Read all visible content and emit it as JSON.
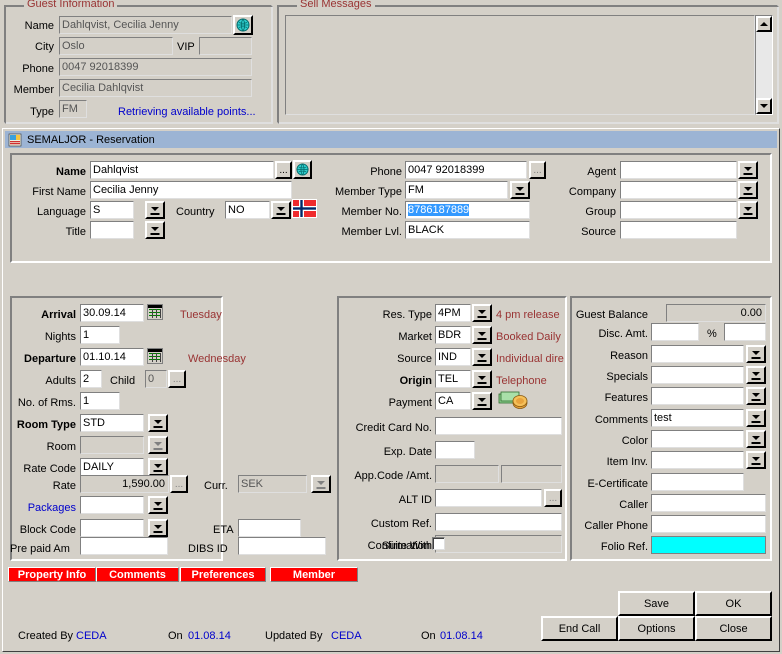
{
  "guest_information": {
    "title": "Guest Information",
    "fields": [
      {
        "label": "Name",
        "value": "Dahlqvist, Cecilia Jenny"
      },
      {
        "label": "City",
        "value": "Oslo"
      },
      {
        "label": "VIP",
        "value": ""
      },
      {
        "label": "Phone",
        "value": "0047  92018399"
      },
      {
        "label": "Member",
        "value": "Cecilia Dahlqvist"
      },
      {
        "label": "Type",
        "value": "FM"
      }
    ],
    "status_text": "Retrieving available points..."
  },
  "sell_messages": {
    "title": "Sell Messages",
    "body": ""
  },
  "window": {
    "title": "SEMALJOR - Reservation"
  },
  "name_section": {
    "name_label": "Name",
    "name_value": "Dahlqvist",
    "first_name_label": "First Name",
    "first_name_value": "Cecilia Jenny",
    "language_label": "Language",
    "language_value": "S",
    "country_label": "Country",
    "country_value": "NO",
    "title_label": "Title",
    "title_value": "",
    "phone_label": "Phone",
    "phone_value": "0047  92018399",
    "member_type_label": "Member Type",
    "member_type_value": "FM",
    "member_no_label": "Member No.",
    "member_no_value": "8786187889",
    "member_lvl_label": "Member Lvl.",
    "member_lvl_value": "BLACK",
    "agent_label": "Agent",
    "agent_value": "",
    "company_label": "Company",
    "company_value": "",
    "group_label": "Group",
    "group_value": "",
    "source_label": "Source",
    "source_value": ""
  },
  "stay_panel": {
    "arrival_label": "Arrival",
    "arrival_value": "30.09.14",
    "arrival_day": "Tuesday",
    "nights_label": "Nights",
    "nights_value": "1",
    "departure_label": "Departure",
    "departure_value": "01.10.14",
    "departure_day": "Wednesday",
    "adults_label": "Adults",
    "adults_value": "2",
    "child_label": "Child",
    "child_value": "0",
    "rooms_label": "No. of Rms.",
    "rooms_value": "1",
    "room_type_label": "Room Type",
    "room_type_value": "STD",
    "room_label": "Room",
    "room_value": "",
    "rate_code_label": "Rate Code",
    "rate_code_value": "DAILY",
    "rate_label": "Rate",
    "rate_value": "1,590.00",
    "curr_label": "Curr.",
    "curr_value": "SEK",
    "packages_label": "Packages",
    "packages_value": "",
    "block_code_label": "Block Code",
    "block_code_value": "",
    "eta_label": "ETA",
    "eta_value": "",
    "pre_paid_label": "Pre paid Am",
    "pre_paid_value": "",
    "dibs_label": "DIBS ID",
    "dibs_value": ""
  },
  "booking_panel": {
    "res_type_label": "Res. Type",
    "res_type_value": "4PM",
    "res_type_desc": "4 pm release",
    "market_label": "Market",
    "market_value": "BDR",
    "market_desc": "Booked Daily",
    "source_label": "Source",
    "source_value": "IND",
    "source_desc": "Individual dire",
    "origin_label": "Origin",
    "origin_value": "TEL",
    "origin_desc": "Telephone",
    "payment_label": "Payment",
    "payment_value": "CA",
    "credit_card_label": "Credit Card No.",
    "credit_card_value": "",
    "exp_date_label": "Exp. Date",
    "exp_date_value": "",
    "app_code_label": "App.Code /Amt.",
    "app_code_value": "",
    "app_amt_value": "",
    "alt_id_label": "ALT ID",
    "alt_id_value": "",
    "custom_ref_label": "Custom Ref.",
    "custom_ref_value": "",
    "suite_with_label": "Suite With",
    "suite_with_value": "",
    "confirmation_label": "Confirmation",
    "confirmation_checked": false
  },
  "financial_panel": {
    "guest_balance_label": "Guest Balance",
    "guest_balance_value": "0.00",
    "disc_amt_label": "Disc. Amt.",
    "disc_amt_value": "",
    "percent_label": "%",
    "percent_value": "",
    "reason_label": "Reason",
    "reason_value": "",
    "specials_label": "Specials",
    "specials_value": "",
    "features_label": "Features",
    "features_value": "",
    "comments_label": "Comments",
    "comments_value": "test",
    "color_label": "Color",
    "color_value": "",
    "item_inv_label": "Item Inv.",
    "item_inv_value": "",
    "e_certificate_label": "E-Certificate",
    "e_certificate_value": "",
    "caller_label": "Caller",
    "caller_value": "",
    "caller_phone_label": "Caller Phone",
    "caller_phone_value": "",
    "folio_ref_label": "Folio Ref.",
    "folio_ref_value": ""
  },
  "tabs": [
    {
      "label": "Property Info"
    },
    {
      "label": "Comments"
    },
    {
      "label": "Preferences"
    },
    {
      "label": "Member"
    }
  ],
  "footer": {
    "created_by_label": "Created By",
    "created_by_value": "CEDA",
    "created_on_label": "On",
    "created_on_value": "01.08.14",
    "updated_by_label": "Updated By",
    "updated_by_value": "CEDA",
    "updated_on_label": "On",
    "updated_on_value": "01.08.14"
  },
  "buttons": {
    "save": "Save",
    "ok": "OK",
    "end_call": "End Call",
    "options": "Options",
    "close": "Close"
  },
  "colors": {
    "face": "#d4d0c8",
    "titlebar": "#9cb4d4",
    "group_title": "#993333",
    "red_tab": "#ff0000",
    "link": "#0000cc",
    "folio_highlight": "#00ffff",
    "selection": "#3399ff"
  },
  "icons": {
    "globe": "globe-icon",
    "flag": "norway-flag-icon",
    "money": "cash-coins-icon",
    "calendar": "calendar-icon",
    "app": "application-icon"
  }
}
